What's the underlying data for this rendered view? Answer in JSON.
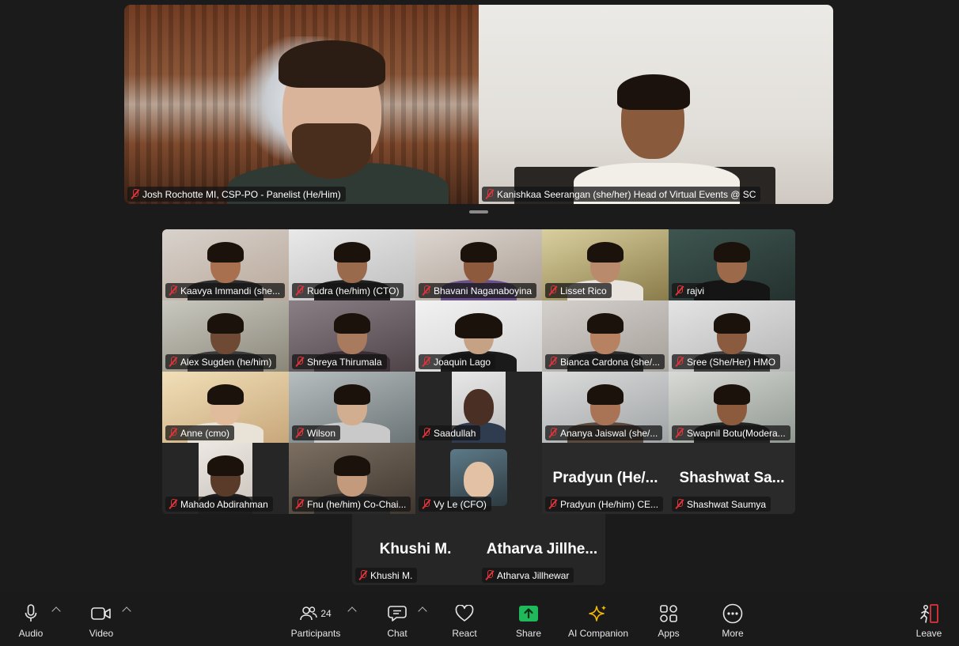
{
  "speakers": [
    {
      "name": "Josh Rochotte MI, CSP-PO - Panelist (He/Him)"
    },
    {
      "name": "Kanishkaa Seerangan (she/her) Head of Virtual Events @ SC"
    }
  ],
  "gallery": [
    {
      "name": "Kaavya Immandi (she..."
    },
    {
      "name": "Rudra (he/him) (CTO)"
    },
    {
      "name": "Bhavani Naganaboyina"
    },
    {
      "name": "Lisset Rico"
    },
    {
      "name": "rajvi"
    },
    {
      "name": "Alex Sugden (he/him)"
    },
    {
      "name": "Shreya Thirumala"
    },
    {
      "name": "Joaquin Lago"
    },
    {
      "name": "Bianca Cardona (she/..."
    },
    {
      "name": "Sree (She/Her) HMO"
    },
    {
      "name": "Anne (cmo)"
    },
    {
      "name": "Wilson"
    },
    {
      "name": "Saadullah"
    },
    {
      "name": "Ananya Jaiswal (she/..."
    },
    {
      "name": "Swapnil Botu(Modera..."
    },
    {
      "name": "Mahado Abdirahman"
    },
    {
      "name": "Fnu (he/him) Co-Chai..."
    },
    {
      "name": "Vy Le (CFO)"
    },
    {
      "name": "Pradyun (He/him) CE...",
      "display": "Pradyun (He/..."
    },
    {
      "name": "Shashwat Saumya",
      "display": "Shashwat Sa..."
    }
  ],
  "extra": [
    {
      "name": "Khushi M.",
      "display": "Khushi M."
    },
    {
      "name": "Atharva Jillhewar",
      "display": "Atharva Jillhe..."
    }
  ],
  "toolbar": {
    "audio": "Audio",
    "video": "Video",
    "participants": "Participants",
    "participants_count": "24",
    "chat": "Chat",
    "react": "React",
    "share": "Share",
    "ai_companion": "AI Companion",
    "apps": "Apps",
    "more": "More",
    "leave": "Leave"
  },
  "icons": {
    "mic": "microphone-icon",
    "video": "video-camera-icon",
    "participants": "people-icon",
    "chat": "chat-bubble-icon",
    "react": "heart-icon",
    "share": "share-screen-icon",
    "ai": "sparkle-icon",
    "apps": "apps-icon",
    "more": "ellipsis-icon",
    "leave": "leave-door-icon",
    "muted": "mic-muted-icon"
  },
  "colors": {
    "share_green": "#1fb85a",
    "leave_red": "#e0333a",
    "ai_gold": "#f5b800",
    "muted_red": "#e0333a"
  }
}
